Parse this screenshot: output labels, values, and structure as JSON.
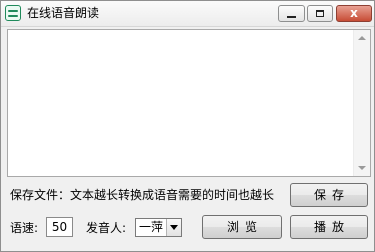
{
  "window": {
    "title": "在线语音朗读",
    "icon": "speech-app-icon",
    "controls": {
      "minimize": "minimize-icon",
      "maximize": "maximize-icon",
      "close_glyph": "x"
    }
  },
  "text_area": {
    "value": ""
  },
  "save_hint": "保存文件：文本越长转换成语音需要的时间也越长",
  "buttons": {
    "save": "保存",
    "browse": "浏览",
    "play": "播放"
  },
  "speed": {
    "label": "语速:",
    "value": "50"
  },
  "speaker": {
    "label": "发音人:",
    "selected": "一萍"
  },
  "colors": {
    "close_button": "#c74c35",
    "window_bg": "#f0f0f0"
  }
}
